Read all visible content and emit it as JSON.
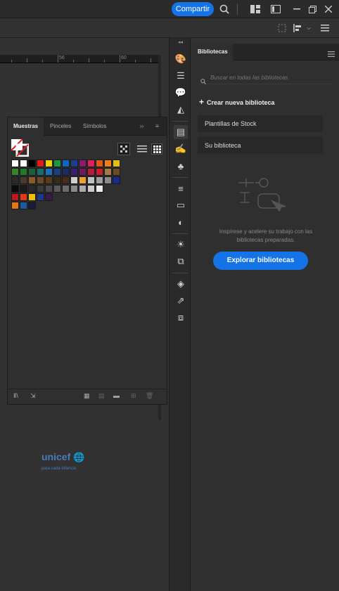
{
  "topbar": {
    "share_label": "Compartir"
  },
  "ruler": {
    "marks": [
      "56",
      "60"
    ]
  },
  "swatch_panel": {
    "tabs": [
      "Muestras",
      "Pinceles",
      "Símbolos"
    ],
    "rows": [
      [
        "#ffffff",
        "#ffffff",
        "#000000",
        "#e31a1c",
        "#f0d000",
        "#1d9a3e",
        "#0c66c2",
        "#1d3d8f",
        "#8a1a6d",
        "#e21f5a",
        "#e05a1a",
        "#ee7f1a",
        "#e0c010"
      ],
      [
        "#39822d",
        "#1f7a2e",
        "#1b5e3b",
        "#1a6a6e",
        "#1d6fb5",
        "#1b3f82",
        "#1e2a66",
        "#3e1f6b",
        "#6e1b5e",
        "#b51d3d",
        "#c8202b",
        "#a07a4a",
        "#6b4a2e"
      ],
      [
        "#2a2a2a",
        "#4a3a2a",
        "#8a5a2a",
        "#6a4a2a",
        "#5a3a1a",
        "#3a2a1a",
        "#4a2a1a",
        "#cfcfcf",
        "#f0a030",
        "#c0c0c0",
        "#a0a0a0",
        "#8a8a8a",
        "#1a2a8a"
      ],
      [
        "#0a0a0a",
        "#1a1a1a",
        "#2a2a2a",
        "#3a3a3a",
        "#4a4a4a",
        "#5a5a5a",
        "#6a6a6a",
        "#8a8a8a",
        "#aaaaaa",
        "#cacaca",
        "#eaeaea"
      ],
      [
        "#c01820",
        "#e03a18",
        "#f0c000",
        "#1a3a8a",
        "#3a1a4a"
      ],
      [
        "#e07818",
        "#1a5aa0",
        "#1a1a3a"
      ]
    ]
  },
  "libraries": {
    "tab_label": "Bibliotecas",
    "search_placeholder": "Buscar en todas las bibliotecas",
    "create_label": "Crear nueva biblioteca",
    "items": [
      "Plantillas de Stock",
      "Su biblioteca"
    ],
    "empty_text": "Inspírese y acelere su trabajo con las bibliotecas preparadas.",
    "explore_label": "Explorar bibliotecas"
  },
  "watermark": {
    "brand": "unicef",
    "tagline": "para cada infancia"
  }
}
